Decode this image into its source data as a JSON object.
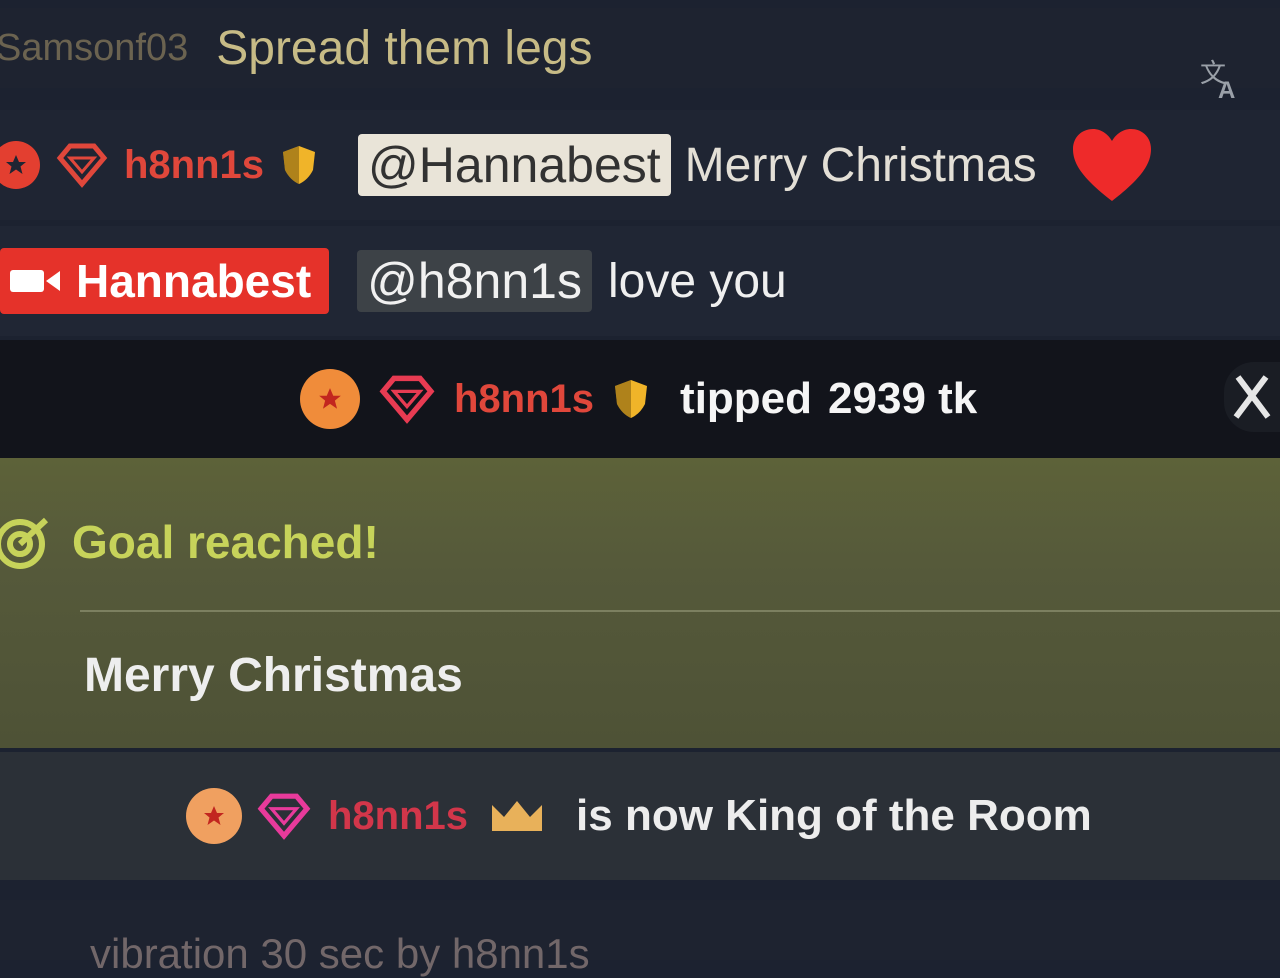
{
  "messages": [
    {
      "user": "Samsonf03",
      "text": "Spread them legs"
    },
    {
      "user": "h8nn1s",
      "mention": "@Hannabest",
      "text": "Merry Christmas"
    },
    {
      "user": "Hannabest",
      "mention": "@h8nn1s",
      "text": "love you"
    }
  ],
  "tip": {
    "user": "h8nn1s",
    "text": "tipped",
    "amount": "2939 tk"
  },
  "goal": {
    "title": "Goal reached!",
    "text": "Merry Christmas"
  },
  "king": {
    "user": "h8nn1s",
    "text": "is now King of the Room"
  },
  "bottom_partial": "vibration 30 sec by h8nn1s",
  "colors": {
    "host_red": "#e5322a",
    "goal_bg": "#5a5e3a",
    "goal_accent": "#c7d35a",
    "heart": "#ee2a2a",
    "user_red": "#e0473b",
    "gem_pink": "#e83a9b"
  }
}
